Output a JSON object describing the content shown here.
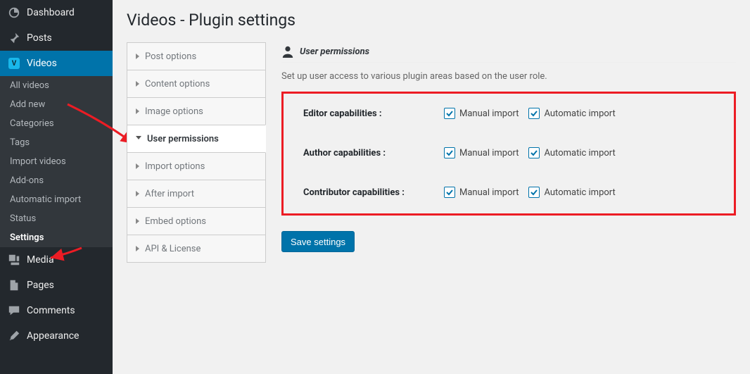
{
  "sidebar": {
    "items": [
      {
        "icon": "dashboard",
        "label": "Dashboard"
      },
      {
        "icon": "pin",
        "label": "Posts"
      },
      {
        "icon": "video",
        "label": "Videos"
      },
      {
        "icon": "media",
        "label": "Media"
      },
      {
        "icon": "page",
        "label": "Pages"
      },
      {
        "icon": "comment",
        "label": "Comments"
      },
      {
        "icon": "brush",
        "label": "Appearance"
      }
    ],
    "sub_videos": [
      "All videos",
      "Add new",
      "Categories",
      "Tags",
      "Import videos",
      "Add-ons",
      "Automatic import",
      "Status",
      "Settings"
    ]
  },
  "page": {
    "title": "Videos - Plugin settings"
  },
  "tabs": [
    "Post options",
    "Content options",
    "Image options",
    "User permissions",
    "Import options",
    "After import",
    "Embed options",
    "API & License"
  ],
  "panel": {
    "title": "User permissions",
    "note": "Set up user access to various plugin areas based on the user role.",
    "caps": [
      {
        "label": "Editor capabilities :",
        "manual": "Manual import",
        "auto": "Automatic import",
        "m": true,
        "a": true
      },
      {
        "label": "Author capabilities :",
        "manual": "Manual import",
        "auto": "Automatic import",
        "m": true,
        "a": true
      },
      {
        "label": "Contributor capabilities :",
        "manual": "Manual import",
        "auto": "Automatic import",
        "m": true,
        "a": true
      }
    ],
    "save": "Save settings"
  }
}
